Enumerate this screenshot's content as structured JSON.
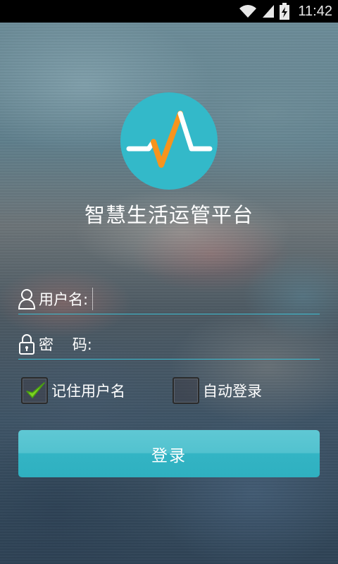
{
  "status_bar": {
    "time": "11:42",
    "icons": [
      "wifi-icon",
      "signal-icon",
      "battery-charging-icon"
    ]
  },
  "app": {
    "title": "智慧生活运管平台",
    "logo_icon": "pulse-wave-icon",
    "brand_color": "#33b9c9",
    "accent_color": "#f7941d"
  },
  "form": {
    "username_label": "用户名:",
    "username_value": "",
    "password_label": "密    码:",
    "password_value": "",
    "remember_label": "记住用户名",
    "remember_checked": true,
    "autologin_label": "自动登录",
    "autologin_checked": false,
    "login_label": "登录"
  }
}
